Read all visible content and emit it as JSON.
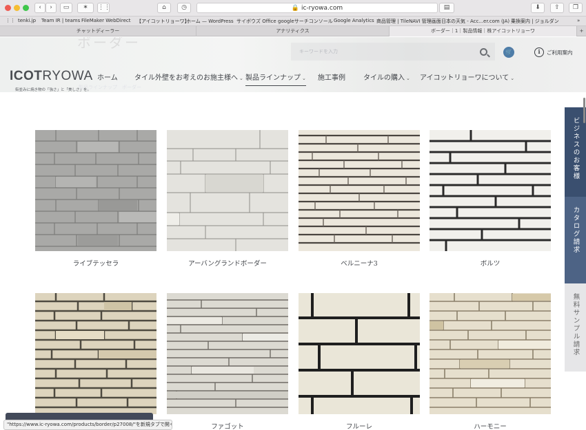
{
  "browser": {
    "url": "ic-ryowa.com",
    "bookmarks": [
      "tenki.jp",
      "Team IR | teams",
      "FileMaker WebDirect",
      "【アイコットリョーワ】",
      "ホーム — WordPress",
      "サイボウズ Office",
      "googleサーチコンソール",
      "Google Analytics",
      "商品管理 | TileNAVI 管理画面",
      "日本の天気 - Acc...er.com (JA)",
      "乗換案内 | ジョルダン"
    ],
    "tabs": [
      "チャットディーラー",
      "アナリティクス",
      "ボーダー｜1｜製品情報｜株アイコットリョーワ"
    ],
    "status_url": "\"https://www.ic-ryowa.com/products/border/p27008/\"を新規タブで開く"
  },
  "header": {
    "ghost_title": "ボーダー",
    "ghost_sub": "製品ラインナップ　ボーダー",
    "logo_bold": "ICOT",
    "logo_light": "RYOWA",
    "tagline": "街並みに焼き物の「強さ」と「美しさ」を。",
    "search_placeholder": "キーワードを入力",
    "guide": "ご利用案内",
    "info_glyph": "i"
  },
  "nav": [
    "ホーム",
    "タイル外壁をお考えのお施主様へ",
    "製品ラインナップ",
    "施工事例",
    "タイルの購入",
    "アイコットリョーワについて"
  ],
  "side_tabs": [
    "ビジネスのお客様",
    "カタログ請求",
    "無料サンプル請求"
  ],
  "products": [
    {
      "name": "ライブテッセラ",
      "style": "gray"
    },
    {
      "name": "アーバングランドボーダー",
      "style": "offwhite"
    },
    {
      "name": "ベルニーナ3",
      "style": "cream-dark"
    },
    {
      "name": "ボルツ",
      "style": "white-black"
    },
    {
      "name": "",
      "style": "beige"
    },
    {
      "name": "ファゴット",
      "style": "rough"
    },
    {
      "name": "フルーレ",
      "style": "cream-wide"
    },
    {
      "name": "ハーモニー",
      "style": "beige-mix"
    }
  ],
  "colors": {
    "nav_text": "#43464b",
    "side_blue": "#3a4f6f",
    "side_mid": "#4d6385",
    "side_light": "#e6e6e8",
    "cart": "#4e7da8"
  }
}
